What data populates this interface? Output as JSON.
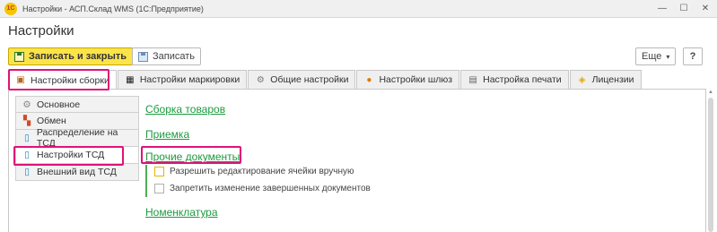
{
  "window": {
    "title": "Настройки - АСП.Склад WMS  (1С:Предприятие)",
    "logo_text": "1С",
    "controls": {
      "minimize": "—",
      "maximize": "☐",
      "close": "✕"
    }
  },
  "form": {
    "title": "Настройки"
  },
  "toolbar": {
    "save_close_label": "Записать и закрыть",
    "save_label": "Записать",
    "more_label": "Еще",
    "more_arrow": "▾",
    "help_label": "?"
  },
  "tabs": [
    {
      "label": "Настройки сборки",
      "icon": "box-icon",
      "glyph": "▣",
      "active": true
    },
    {
      "label": "Настройки маркировки",
      "icon": "qr-code-icon",
      "glyph": "▦"
    },
    {
      "label": "Общие настройки",
      "icon": "settings-icon",
      "glyph": "⚙"
    },
    {
      "label": "Настройки шлюз",
      "icon": "gateway-icon",
      "glyph": "●"
    },
    {
      "label": "Настройка печати",
      "icon": "printer-icon",
      "glyph": "▤"
    },
    {
      "label": "Лицензии",
      "icon": "shield-icon",
      "glyph": "◈"
    }
  ],
  "sidebar": {
    "items": [
      {
        "label": "Основное",
        "icon": "settings-icon",
        "glyph": "⚙"
      },
      {
        "label": "Обмен",
        "icon": "exchange-icon",
        "glyph": "▚"
      },
      {
        "label": "Распределение на ТСД",
        "icon": "mobile-device-icon",
        "glyph": "▯"
      },
      {
        "label": "Настройки ТСД",
        "icon": "mobile-device-icon",
        "glyph": "▯",
        "active": true
      },
      {
        "label": "Внешний вид ТСД",
        "icon": "mobile-device-icon",
        "glyph": "▯"
      }
    ]
  },
  "main": {
    "sections": [
      "Сборка товаров",
      "Приемка",
      "Прочие документы",
      "Номенклатура"
    ],
    "checkboxes": [
      {
        "label": "Разрешить редактирование ячейки вручную",
        "checked": false
      },
      {
        "label": "Запретить изменение завершенных документов",
        "checked": false
      }
    ]
  },
  "colors": {
    "primary_button": "#fbe34a",
    "link": "#1c9a3f",
    "highlight": "#e0127a",
    "group_line": "#4caf50"
  },
  "scrollbar": {
    "up_arrow": "▲"
  }
}
